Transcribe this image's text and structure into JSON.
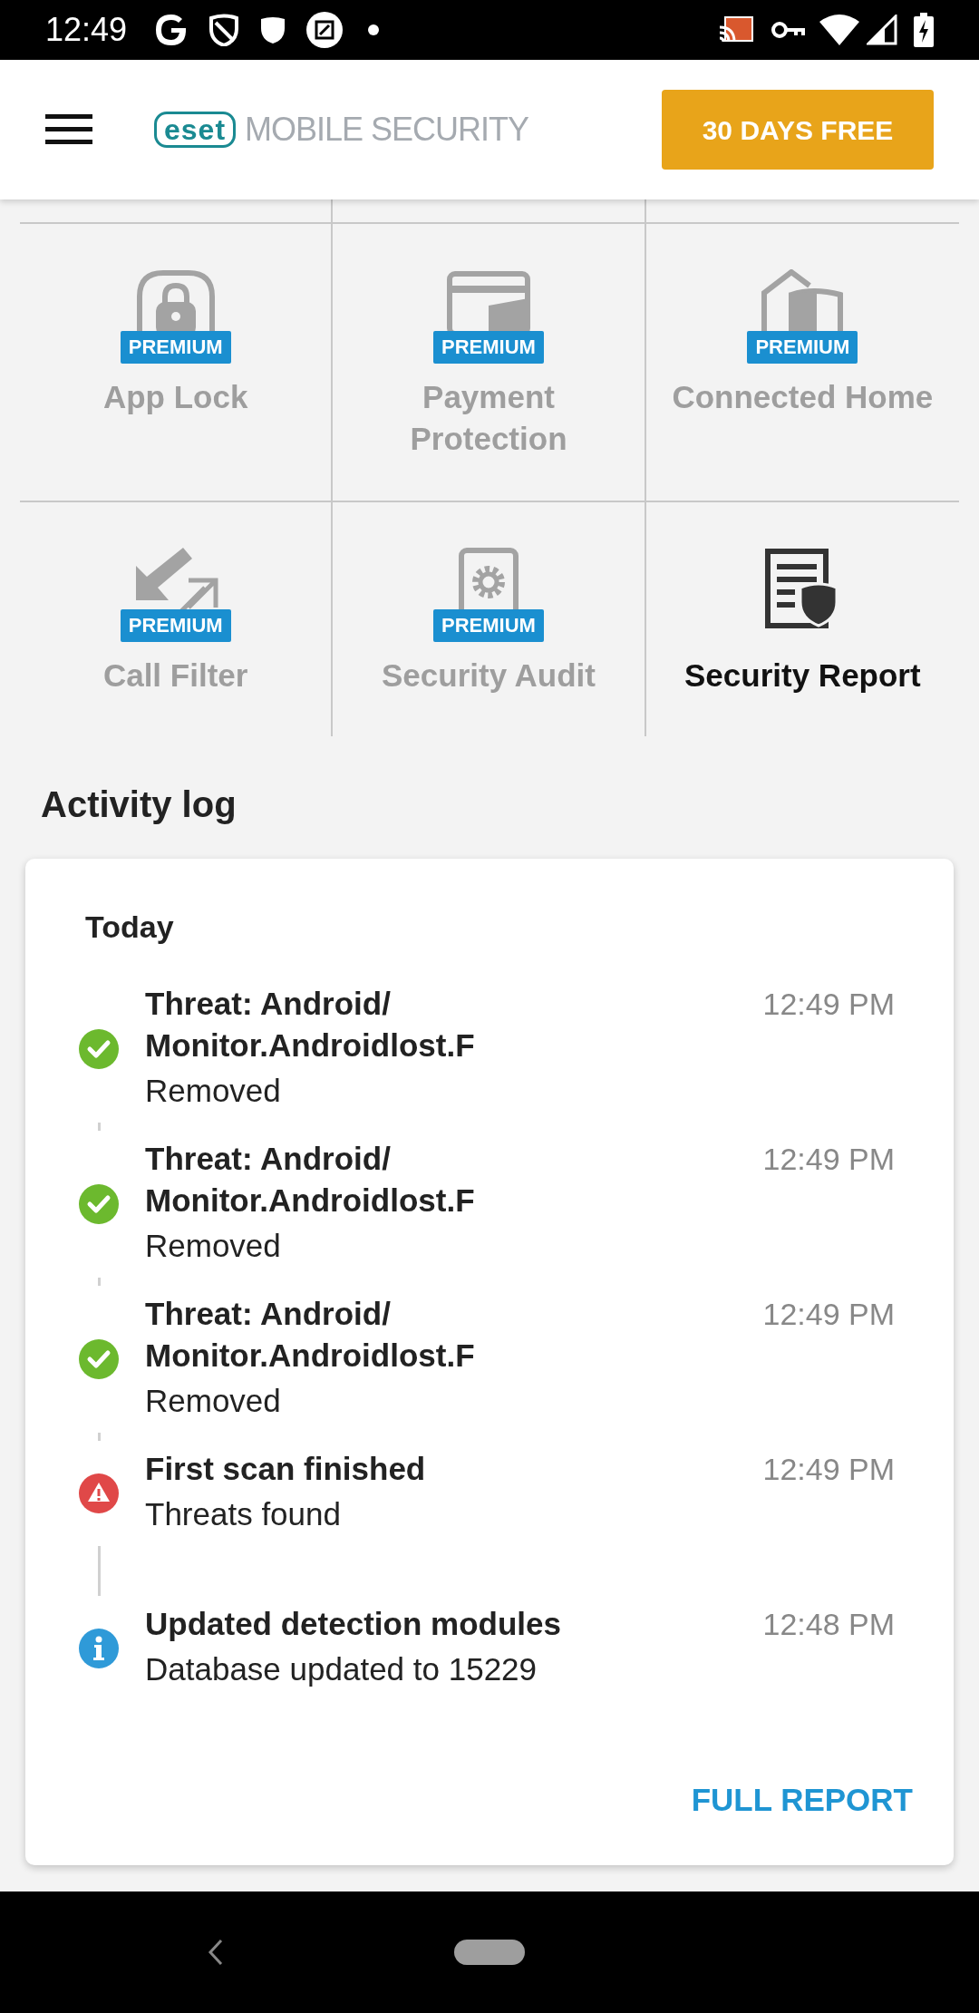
{
  "status_bar": {
    "time": "12:49"
  },
  "header": {
    "logo": "eset",
    "product": "MOBILE SECURITY",
    "trial_button": "30 DAYS FREE"
  },
  "features": [
    {
      "kind": "app_lock",
      "label": "App Lock",
      "badge": "PREMIUM"
    },
    {
      "kind": "payment",
      "label": "Payment Protection",
      "badge": "PREMIUM"
    },
    {
      "kind": "home",
      "label": "Connected Home",
      "badge": "PREMIUM"
    },
    {
      "kind": "call_filter",
      "label": "Call Filter",
      "badge": "PREMIUM"
    },
    {
      "kind": "audit",
      "label": "Security Audit",
      "badge": "PREMIUM"
    },
    {
      "kind": "report",
      "label": "Security Report"
    }
  ],
  "activity_log": {
    "title": "Activity log",
    "day": "Today",
    "entries": [
      {
        "kind": "success",
        "title": "Threat: Android/Monitor.Androidlost.F",
        "detail": "Removed",
        "time": "12:49 PM"
      },
      {
        "kind": "success",
        "title": "Threat: Android/Monitor.Androidlost.F",
        "detail": "Removed",
        "time": "12:49 PM"
      },
      {
        "kind": "success",
        "title": "Threat: Android/Monitor.Androidlost.F",
        "detail": "Removed",
        "time": "12:49 PM"
      },
      {
        "kind": "warning",
        "title": "First scan finished",
        "detail": "Threats found",
        "time": "12:49 PM"
      },
      {
        "kind": "info",
        "title": "Updated detection modules",
        "detail": "Database updated to 15229",
        "time": "12:48 PM"
      }
    ],
    "full_report": "FULL REPORT"
  }
}
